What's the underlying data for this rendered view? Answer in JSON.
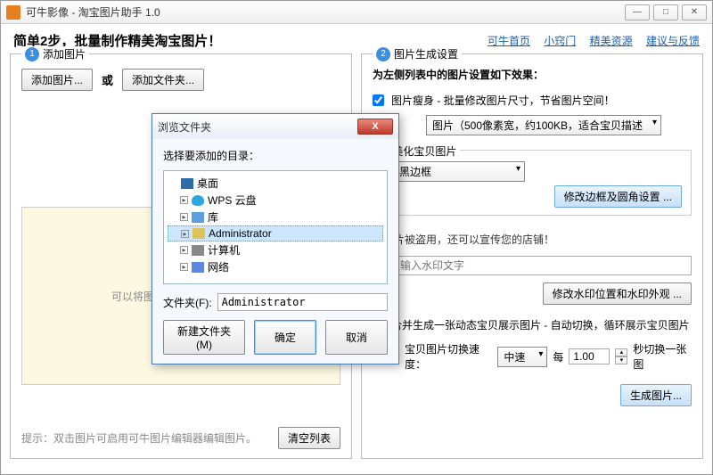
{
  "app": {
    "title": "可牛影像 - 淘宝图片助手 1.0"
  },
  "header": {
    "title": "简单2步，批量制作精美淘宝图片！",
    "links": [
      "可牛首页",
      "小窍门",
      "精美资源",
      "建议与反馈"
    ]
  },
  "left": {
    "num": "1",
    "title": "添加图片",
    "btn_add_images": "添加图片...",
    "or": "或",
    "btn_add_folder": "添加文件夹...",
    "dropzone_hint": "可以将图片文件拽进来，加入",
    "tip": "提示：双击图片可启用可牛图片编辑器编辑图片。",
    "btn_clear": "清空列表"
  },
  "right": {
    "num": "2",
    "title": "图片生成设置",
    "subtitle": "为左侧列表中的图片设置如下效果：",
    "slim_label": "图片瘦身 - 批量修改图片尺寸，节省图片空间！",
    "slim_option": "图片（500像素宽，约100KB，适合宝贝描述",
    "beautify_group": "美化宝贝图片",
    "beautify_option": "粗黑边框",
    "btn_border": "修改边框及圆角设置 ...",
    "watermark_hint": "止图片被盗用，还可以宣传您的店铺！",
    "watermark_placeholder": "此处输入水印文字",
    "btn_watermark": "修改水印位置和水印外观 ...",
    "merge_label": "合并生成一张动态宝贝展示图片 - 自动切换，循环展示宝贝图片",
    "speed_label": "宝贝图片切换速度：",
    "speed_value": "中速",
    "every": "每",
    "seconds": "1.00",
    "seconds_suffix": "秒切换一张图",
    "btn_generate": "生成图片..."
  },
  "dialog": {
    "title": "浏览文件夹",
    "prompt": "选择要添加的目录：",
    "items": [
      {
        "label": "桌面",
        "icon": "desktop",
        "expander": ""
      },
      {
        "label": "WPS 云盘",
        "icon": "cloud",
        "expander": "▸",
        "indent": true
      },
      {
        "label": "库",
        "icon": "lib",
        "expander": "▸",
        "indent": true
      },
      {
        "label": "Administrator",
        "icon": "user",
        "expander": "▸",
        "indent": true,
        "selected": true
      },
      {
        "label": "计算机",
        "icon": "computer",
        "expander": "▸",
        "indent": true
      },
      {
        "label": "网络",
        "icon": "net",
        "expander": "▸",
        "indent": true
      }
    ],
    "path_label": "文件夹(F):",
    "path_value": "Administrator",
    "btn_new": "新建文件夹(M)",
    "btn_ok": "确定",
    "btn_cancel": "取消"
  }
}
